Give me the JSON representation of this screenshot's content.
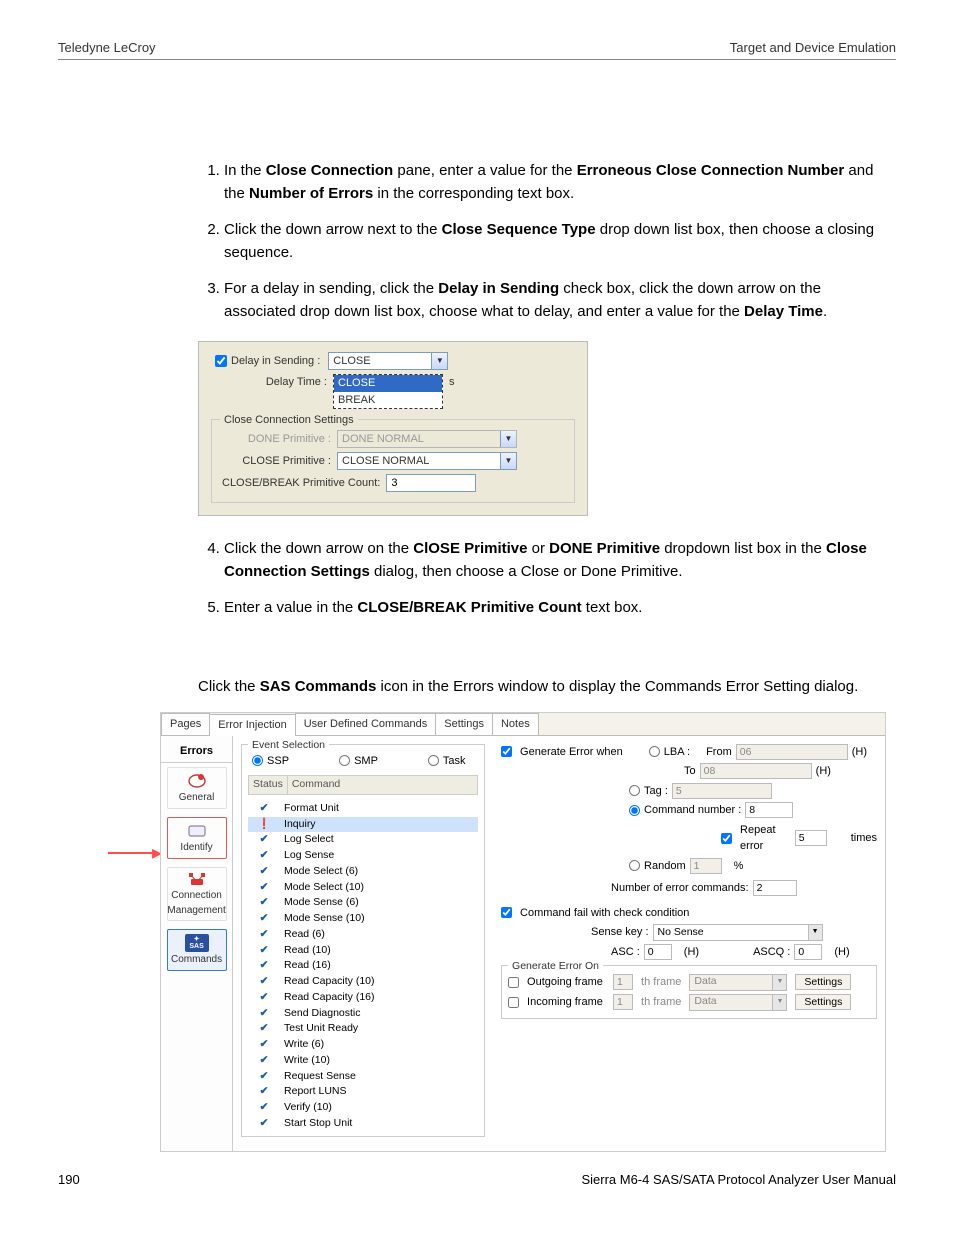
{
  "header": {
    "left": "Teledyne LeCroy",
    "right": "Target and Device Emulation"
  },
  "steps": [
    {
      "pre": "In the ",
      "b1": "Close Connection",
      "mid1": " pane, enter a value for the ",
      "b2": "Erroneous Close Connection Number",
      "mid2": " and the ",
      "b3": "Number of Errors",
      "post": " in the corresponding text box."
    },
    {
      "pre": "Click the down arrow next to the ",
      "b1": "Close Sequence Type",
      "post": " drop down list box, then choose a closing sequence."
    },
    {
      "pre": "For a delay in sending, click the ",
      "b1": "Delay in Sending",
      "mid1": " check box, click the down arrow on the associated drop down list box, choose what to delay, and enter a value for the ",
      "b2": "Delay Time",
      "post": "."
    }
  ],
  "fig1": {
    "delay_sending_label": "Delay in Sending :",
    "delay_sending_value": "CLOSE",
    "delay_time_label": "Delay Time :",
    "options": [
      "CLOSE",
      "BREAK"
    ],
    "unit": "s",
    "group_title": "Close Connection Settings",
    "done_label": "DONE Primitive :",
    "done_value": "DONE NORMAL",
    "close_label": "CLOSE Primitive :",
    "close_value": "CLOSE NORMAL",
    "count_label": "CLOSE/BREAK Primitive Count:",
    "count_value": "3"
  },
  "steps2": [
    {
      "pre": "Click the down arrow on the ",
      "b1": "ClOSE Primitive",
      "mid1": " or ",
      "b2": "DONE Primitive",
      "mid2": " dropdown list box in the ",
      "b3": "Close Connection Settings",
      "post": " dialog, then choose a Close or Done Primitive."
    },
    {
      "pre": "Enter a value in the ",
      "b1": "CLOSE/BREAK Primitive Count",
      "post": " text box."
    }
  ],
  "intro": {
    "pre": "Click the ",
    "b1": "SAS Commands",
    "post": " icon in the Errors window to display the Commands Error Setting dialog."
  },
  "app": {
    "tabs": [
      "Pages",
      "Error Injection",
      "User Defined Commands",
      "Settings",
      "Notes"
    ],
    "sidebar": {
      "header": "Errors",
      "items": [
        {
          "id": "general",
          "label": "General",
          "icon": "🔴"
        },
        {
          "id": "identify",
          "label": "Identify",
          "icon": "▭"
        },
        {
          "id": "connmgmt",
          "label": "Connection Management",
          "icon": "🕹️"
        },
        {
          "id": "sascmd",
          "label": "Commands",
          "icon": "SAS"
        }
      ]
    },
    "eventsel": {
      "title": "Event Selection",
      "radios": [
        "SSP",
        "SMP",
        "Task"
      ],
      "colStatus": "Status",
      "colCmd": "Command",
      "commands": [
        {
          "s": "check",
          "n": "Format Unit"
        },
        {
          "s": "excl",
          "n": "Inquiry",
          "sel": true
        },
        {
          "s": "check",
          "n": "Log Select"
        },
        {
          "s": "check",
          "n": "Log Sense"
        },
        {
          "s": "check",
          "n": "Mode Select (6)"
        },
        {
          "s": "check",
          "n": "Mode Select (10)"
        },
        {
          "s": "check",
          "n": "Mode Sense (6)"
        },
        {
          "s": "check",
          "n": "Mode Sense (10)"
        },
        {
          "s": "check",
          "n": "Read (6)"
        },
        {
          "s": "check",
          "n": "Read (10)"
        },
        {
          "s": "check",
          "n": "Read (16)"
        },
        {
          "s": "check",
          "n": "Read Capacity (10)"
        },
        {
          "s": "check",
          "n": "Read Capacity (16)"
        },
        {
          "s": "check",
          "n": "Send Diagnostic"
        },
        {
          "s": "check",
          "n": "Test Unit Ready"
        },
        {
          "s": "check",
          "n": "Write (6)"
        },
        {
          "s": "check",
          "n": "Write (10)"
        },
        {
          "s": "check",
          "n": "Request Sense"
        },
        {
          "s": "check",
          "n": "Report LUNS"
        },
        {
          "s": "check",
          "n": "Verify (10)"
        },
        {
          "s": "check",
          "n": "Start Stop Unit"
        }
      ]
    },
    "right": {
      "gen_when": "Generate Error when",
      "lba": "LBA :",
      "from": "From",
      "from_v": "06",
      "to": "To",
      "to_v": "08",
      "tag": "Tag :",
      "tag_v": "5",
      "cmdnum": "Command number :",
      "cmdnum_v": "8",
      "repeat": "Repeat error",
      "repeat_v": "5",
      "times": "times",
      "random": "Random",
      "random_v": "1",
      "random_pct": "%",
      "num_err": "Number of error commands:",
      "num_err_v": "2",
      "cfail": "Command fail with check condition",
      "sensekey": "Sense key :",
      "sensekey_v": "No Sense",
      "asc": "ASC :",
      "asc_v": "0",
      "ascq": "ASCQ :",
      "ascq_v": "0",
      "hexsuffix": "(H)",
      "geo_title": "Generate Error On",
      "out": "Outgoing frame",
      "out_v": "1",
      "in": "Incoming frame",
      "in_v": "1",
      "thframe": "th frame",
      "data": "Data",
      "settings": "Settings"
    }
  },
  "footer": {
    "left": "190",
    "right": "Sierra M6-4 SAS/SATA Protocol Analyzer User Manual"
  }
}
